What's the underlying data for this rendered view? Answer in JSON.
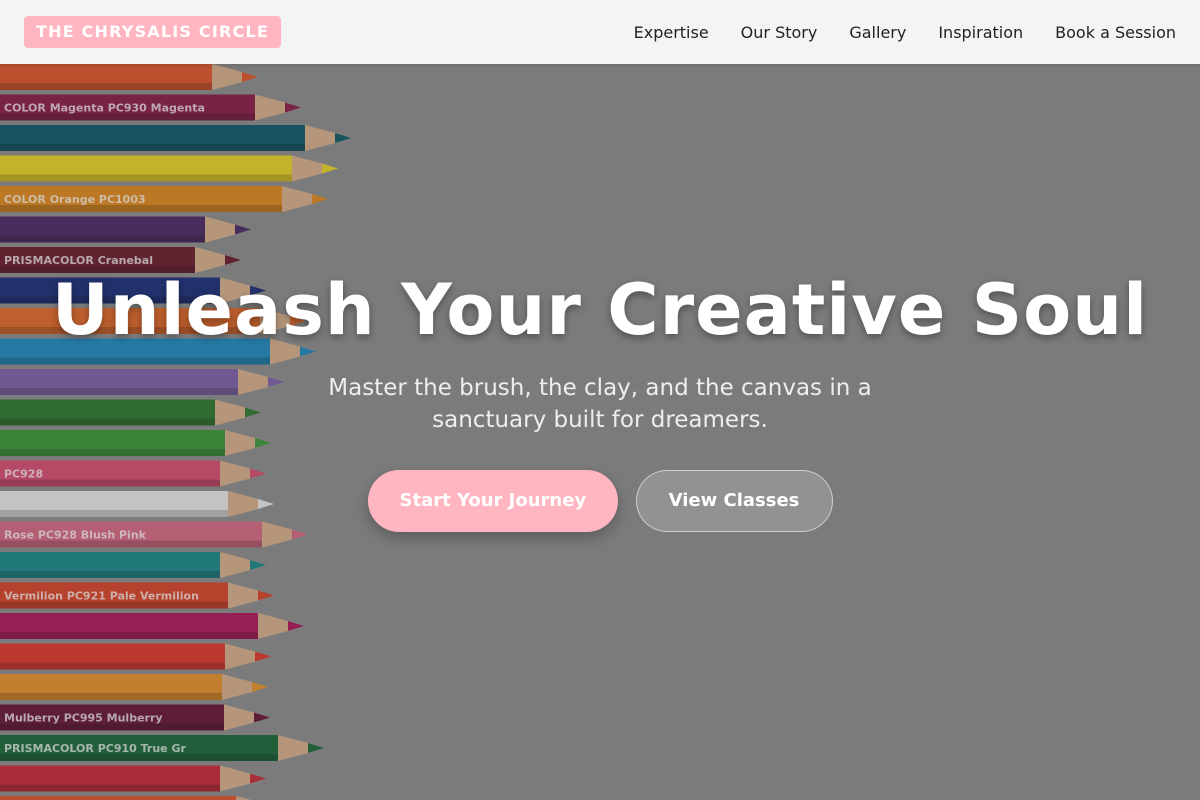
{
  "brand": {
    "name": "THE CHRYSALIS CIRCLE",
    "accent": "#ffb6c1"
  },
  "nav": {
    "items": [
      {
        "label": "Expertise"
      },
      {
        "label": "Our Story"
      },
      {
        "label": "Gallery"
      },
      {
        "label": "Inspiration"
      },
      {
        "label": "Book a Session"
      }
    ]
  },
  "hero": {
    "title": "Unleash Your Creative Soul",
    "subtitle": "Master the brush, the clay, and the canvas in a sanctuary built for dreamers.",
    "primary_cta": "Start Your Journey",
    "secondary_cta": "View Classes",
    "background_image": "colored-pencils-photo",
    "pencils": [
      {
        "color": "#e0562b",
        "text": ""
      },
      {
        "color": "#8a1c4a",
        "text": "COLOR    Magenta    PC930    Magenta"
      },
      {
        "color": "#0f5a6a",
        "text": ""
      },
      {
        "color": "#e9d426",
        "text": ""
      },
      {
        "color": "#e08a1e",
        "text": "COLOR    Orange    PC1003"
      },
      {
        "color": "#4c2a66",
        "text": ""
      },
      {
        "color": "#6b1e2e",
        "text": "PRISMACOLOR    Cranebal"
      },
      {
        "color": "#1b2f7a",
        "text": ""
      },
      {
        "color": "#e36a2a",
        "text": ""
      },
      {
        "color": "#1f8bc0",
        "text": ""
      },
      {
        "color": "#7e62a8",
        "text": ""
      },
      {
        "color": "#2f7a34",
        "text": ""
      },
      {
        "color": "#3c9a3a",
        "text": ""
      },
      {
        "color": "#d84d73",
        "text": "PC928"
      },
      {
        "color": "#eaeaea",
        "text": ""
      },
      {
        "color": "#d86a84",
        "text": "Rose    PC928    Blush Pink"
      },
      {
        "color": "#1a8a8a",
        "text": ""
      },
      {
        "color": "#d9432a",
        "text": "Vermilion    PC921    Pale Vermilion"
      },
      {
        "color": "#b0185a",
        "text": ""
      },
      {
        "color": "#e0382c",
        "text": ""
      },
      {
        "color": "#e8922a",
        "text": ""
      },
      {
        "color": "#6a1638",
        "text": "Mulberry    PC995    Mulberry"
      },
      {
        "color": "#1a6a3a",
        "text": "PRISMACOLOR    PC910    True Gr"
      },
      {
        "color": "#c82a3a",
        "text": ""
      },
      {
        "color": "#e0562b",
        "text": ""
      }
    ]
  }
}
